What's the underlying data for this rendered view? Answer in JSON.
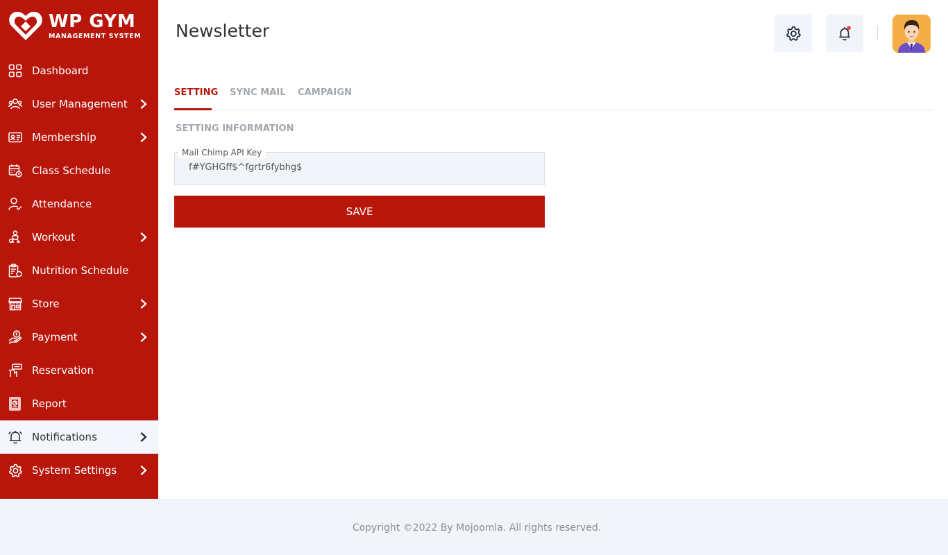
{
  "brand": {
    "name": "WP GYM",
    "tagline": "MANAGEMENT SYSTEM"
  },
  "sidebar": {
    "items": [
      {
        "label": "Dashboard",
        "icon": "dashboard-icon",
        "has_submenu": false
      },
      {
        "label": "User Management",
        "icon": "users-icon",
        "has_submenu": true
      },
      {
        "label": "Membership",
        "icon": "membership-card-icon",
        "has_submenu": true
      },
      {
        "label": "Class Schedule",
        "icon": "calendar-icon",
        "has_submenu": false
      },
      {
        "label": "Attendance",
        "icon": "user-check-icon",
        "has_submenu": false
      },
      {
        "label": "Workout",
        "icon": "workout-icon",
        "has_submenu": true
      },
      {
        "label": "Nutrition Schedule",
        "icon": "nutrition-icon",
        "has_submenu": false
      },
      {
        "label": "Store",
        "icon": "store-icon",
        "has_submenu": true
      },
      {
        "label": "Payment",
        "icon": "payment-icon",
        "has_submenu": true
      },
      {
        "label": "Reservation",
        "icon": "reservation-icon",
        "has_submenu": false
      },
      {
        "label": "Report",
        "icon": "report-icon",
        "has_submenu": false
      },
      {
        "label": "Notifications",
        "icon": "bell-icon",
        "has_submenu": true,
        "active": true
      },
      {
        "label": "System Settings",
        "icon": "gear-icon",
        "has_submenu": true
      }
    ]
  },
  "header": {
    "title": "Newsletter",
    "settings_icon": "gear-icon",
    "notification_icon": "bell-icon",
    "avatar_icon": "user-avatar"
  },
  "tabs": [
    {
      "label": "SETTING",
      "active": true
    },
    {
      "label": "SYNC MAIL",
      "active": false
    },
    {
      "label": "CAMPAIGN",
      "active": false
    }
  ],
  "form": {
    "section_title": "SETTING INFORMATION",
    "api_key_label": "Mail Chimp API Key",
    "api_key_value": "f#YGHGff$^fgrtr6fybhg$",
    "save_label": "SAVE"
  },
  "footer": {
    "copyright": "Copyright ©2022 By Mojoomla. All rights reserved."
  },
  "colors": {
    "brand_red": "#b8160b",
    "sidebar_active_bg": "#f3f6fa",
    "footer_bg": "#f1f4f8",
    "notification_dot": "#e84a3b",
    "avatar_bg": "#f5ad46"
  }
}
